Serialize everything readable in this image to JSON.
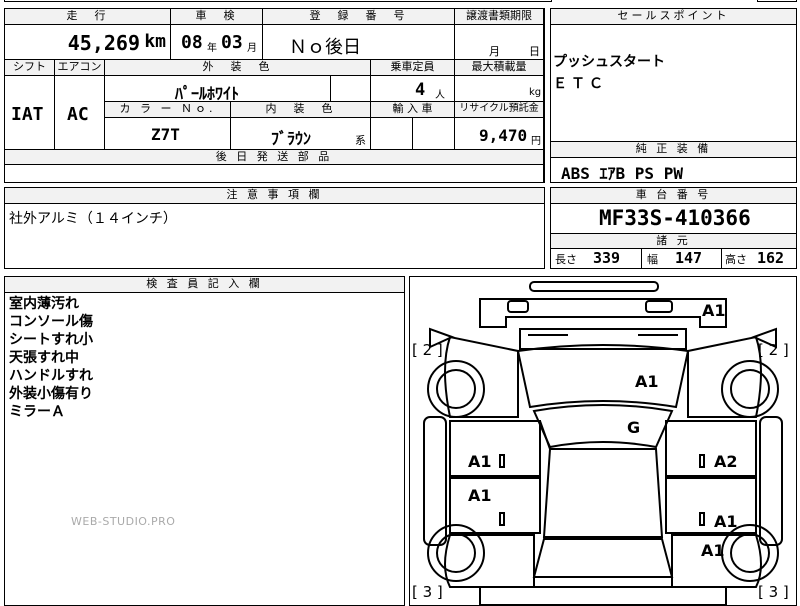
{
  "top": {
    "labels": {
      "mileage": "走　行",
      "inspection": "車　検",
      "registration": "登　録　番　号",
      "transfer_deadline": "譲渡書類期限",
      "sales_point": "セールスポイント"
    },
    "mileage_value": "45,269",
    "mileage_unit": "km",
    "inspection_year": "08",
    "inspection_year_unit": "年",
    "inspection_month": "03",
    "inspection_month_unit": "月",
    "registration_value": "Ｎｏ後日",
    "transfer_month_unit": "月",
    "transfer_day_unit": "日",
    "sales_points": [
      "プッシュスタート",
      "ＥＴＣ"
    ]
  },
  "spec": {
    "labels": {
      "shift": "シフト",
      "aircon": "エアコン",
      "exterior_color": "外　装　色",
      "capacity": "乗車定員",
      "max_load": "最大積載量",
      "color_no": "カ ラ ー Ｎｏ.",
      "interior_color": "内　装　色",
      "import": "輸 入 車",
      "recycle": "リサイクル預託金",
      "later_parts": "後 日 発 送 部 品",
      "genuine_equipment": "純 正 装 備"
    },
    "shift_value": "IAT",
    "aircon_value": "AC",
    "exterior_color_value": "ﾊﾟｰﾙﾎﾜｲﾄ",
    "capacity_value": "4",
    "capacity_unit": "人",
    "max_load_unit": "kg",
    "color_no_value": "Z7T",
    "interior_color_value": "ﾌﾞﾗｳﾝ",
    "interior_color_unit": "系",
    "recycle_value": "9,470",
    "recycle_unit": "円",
    "genuine_equipment_value": "ABS ｴｱB PS PW"
  },
  "notes": {
    "label": "注 意 事 項 欄",
    "value": "社外アルミ（１４インチ）"
  },
  "chassis": {
    "label": "車 台 番 号",
    "value": "MF33S-410366",
    "dims_label": "諸 元",
    "length_label": "長さ",
    "length_value": "339",
    "width_label": "幅",
    "width_value": "147",
    "height_label": "高さ",
    "height_value": "162"
  },
  "inspector": {
    "label": "検 査 員 記 入 欄",
    "lines": [
      "室内薄汚れ",
      "コンソール傷",
      "シートすれ小",
      "天張すれ中",
      "ハンドルすれ",
      "外装小傷有り",
      "ミラーＡ"
    ]
  },
  "diagram": {
    "marks": {
      "a1_top_right": "A1",
      "a1_hood": "A1",
      "g_windshield": "G",
      "a1_left_front_door": "A1",
      "a1_left_rear_door": "A1",
      "a2_right_front_door": "A2",
      "a1_right_rear_door": "A1",
      "a1_right_rear_fender": "A1"
    },
    "brackets": {
      "left_top": "[ 2 ]",
      "right_top": "[ 2 ]",
      "left_bottom": "[ 3 ]",
      "right_bottom": "[ 3 ]"
    }
  },
  "watermark": "WEB-STUDIO.PRO"
}
